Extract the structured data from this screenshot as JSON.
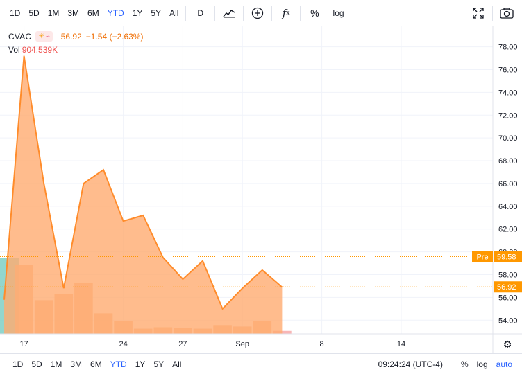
{
  "toolbar": {
    "ranges": [
      "1D",
      "5D",
      "1M",
      "3M",
      "6M",
      "YTD",
      "1Y",
      "5Y",
      "All"
    ],
    "active_range": "YTD",
    "interval": "D",
    "percent": "%",
    "log": "log",
    "icons": [
      "chart-type-icon",
      "compare-add-icon",
      "indicators-fx-icon",
      "fullscreen-icon",
      "camera-snapshot-icon"
    ]
  },
  "legend": {
    "symbol": "CVAC",
    "price": "56.92",
    "change": "−1.54 (−2.63%)",
    "vol_label": "Vol",
    "vol_value": "904.539K"
  },
  "bottom": {
    "ranges": [
      "1D",
      "5D",
      "1M",
      "3M",
      "6M",
      "YTD",
      "1Y",
      "5Y",
      "All"
    ],
    "active_range": "YTD",
    "time": "09:24:24 (UTC-4)",
    "percent": "%",
    "log": "log",
    "auto": "auto"
  },
  "colors": {
    "line": "#ff8c2b",
    "area": "#ffab70",
    "accent": "#2962ff",
    "pre_label": "#ff9800",
    "price_label": "#ff9800"
  },
  "chart_data": {
    "type": "area",
    "x": [
      "Aug 16",
      "Aug 17",
      "Aug 18",
      "Aug 19",
      "Aug 20",
      "Aug 23",
      "Aug 24",
      "Aug 25",
      "Aug 26",
      "Aug 27",
      "Aug 30",
      "Aug 31",
      "Sep 1",
      "Sep 2",
      "Sep 3"
    ],
    "values": [
      55.8,
      77.2,
      66.0,
      56.8,
      66.0,
      67.2,
      62.7,
      63.2,
      59.5,
      57.6,
      59.2,
      55.0,
      56.8,
      58.4,
      56.9
    ],
    "volume": [
      5200,
      4700,
      2300,
      2700,
      3500,
      1400,
      900,
      350,
      450,
      400,
      350,
      600,
      500,
      850,
      200
    ],
    "y_ticks": [
      "54.00",
      "56.00",
      "58.00",
      "60.00",
      "62.00",
      "64.00",
      "66.00",
      "68.00",
      "70.00",
      "72.00",
      "74.00",
      "76.00",
      "78.00"
    ],
    "ylim": [
      52.8,
      79.8
    ],
    "x_ticks": [
      "17",
      "24",
      "27",
      "Sep",
      "8",
      "14"
    ],
    "pre_label": "Pre",
    "pre_value": "59.58",
    "pre_numeric": 59.58,
    "last_value": "56.92",
    "last_numeric": 56.92,
    "grid": true
  }
}
